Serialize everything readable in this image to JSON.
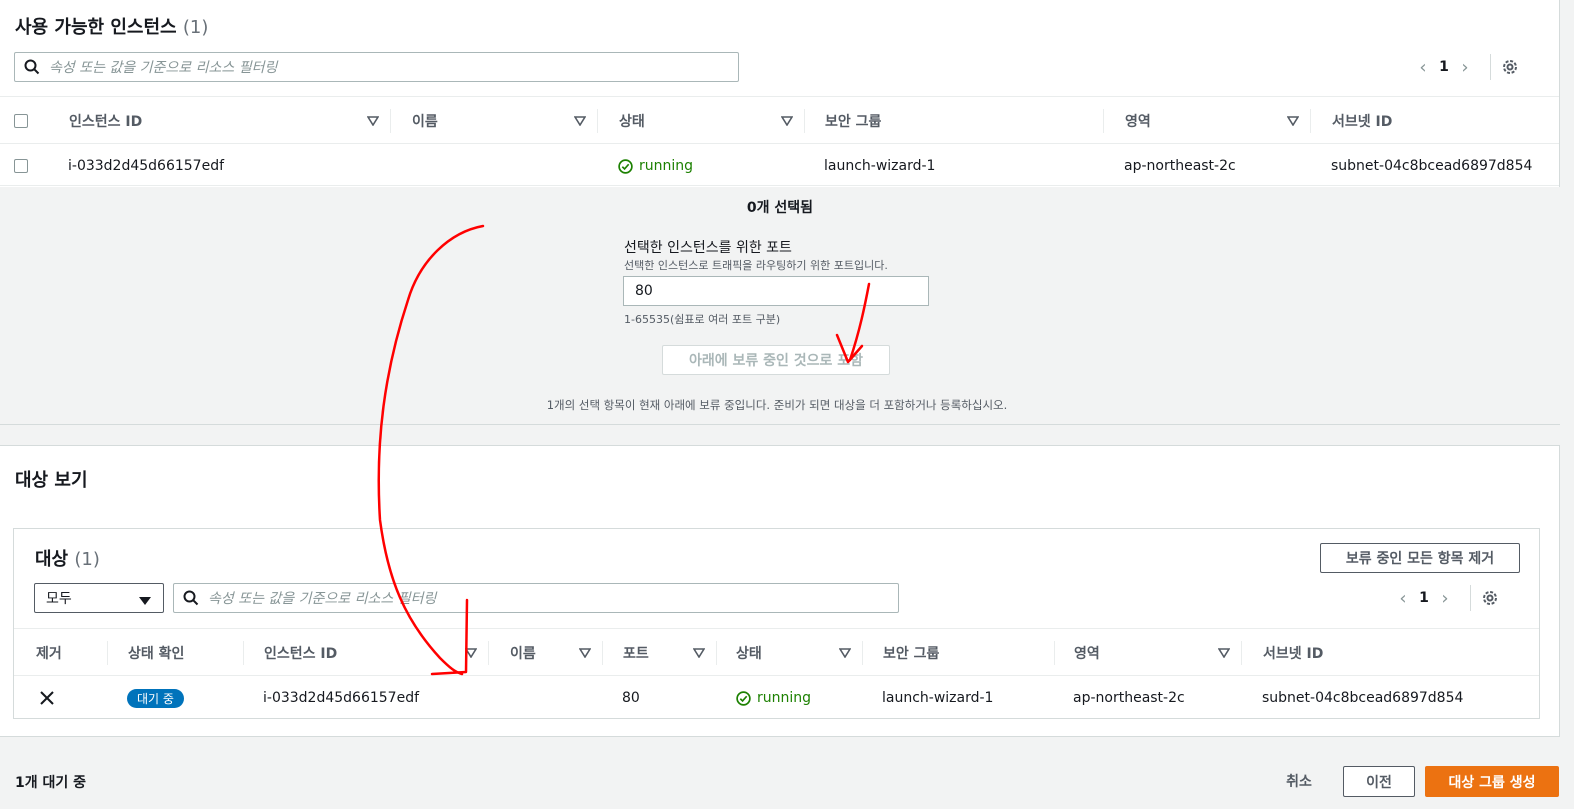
{
  "available": {
    "title": "사용 가능한 인스턴스",
    "count": "(1)",
    "search_placeholder": "속성 또는 값을 기준으로 리소스 필터링",
    "page": "1",
    "columns": [
      "인스턴스 ID",
      "이름",
      "상태",
      "보안 그룹",
      "영역",
      "서브넷 ID"
    ],
    "row": {
      "instance_id": "i-033d2d45d66157edf",
      "name": "",
      "state": "running",
      "security_group": "launch-wizard-1",
      "zone": "ap-northeast-2c",
      "subnet_id": "subnet-04c8bcead6897d854"
    }
  },
  "selection": {
    "selected_count": "0개 선택됨",
    "port_label": "선택한 인스턴스를 위한 포트",
    "port_desc": "선택한 인스턴스로 트래픽을 라우팅하기 위한 포트입니다.",
    "port_value": "80",
    "port_hint": "1-65535(쉼표로 여러 포트 구분)",
    "include_button": "아래에 보류 중인 것으로 포함",
    "note": "1개의 선택 항목이 현재 아래에 보류 중입니다. 준비가 되면 대상을 더 포함하거나 등록하십시오."
  },
  "target_view": {
    "title": "대상 보기",
    "targets_title": "대상",
    "targets_count": "(1)",
    "remove_all_button": "보류 중인 모든 항목 제거",
    "filter_select": "모두",
    "search_placeholder": "속성 또는 값을 기준으로 리소스 필터링",
    "page": "1",
    "columns": [
      "제거",
      "상태 확인",
      "인스턴스 ID",
      "이름",
      "포트",
      "상태",
      "보안 그룹",
      "영역",
      "서브넷 ID"
    ],
    "row": {
      "health": "대기 중",
      "instance_id": "i-033d2d45d66157edf",
      "name": "",
      "port": "80",
      "state": "running",
      "security_group": "launch-wizard-1",
      "zone": "ap-northeast-2c",
      "subnet_id": "subnet-04c8bcead6897d854"
    }
  },
  "footer": {
    "pending": "1개 대기 중",
    "cancel": "취소",
    "previous": "이전",
    "create": "대상 그룹 생성"
  },
  "colors": {
    "accent": "#ec7211",
    "running": "#1d8102",
    "badge": "#0073bb",
    "annotation": "#ff0000"
  }
}
